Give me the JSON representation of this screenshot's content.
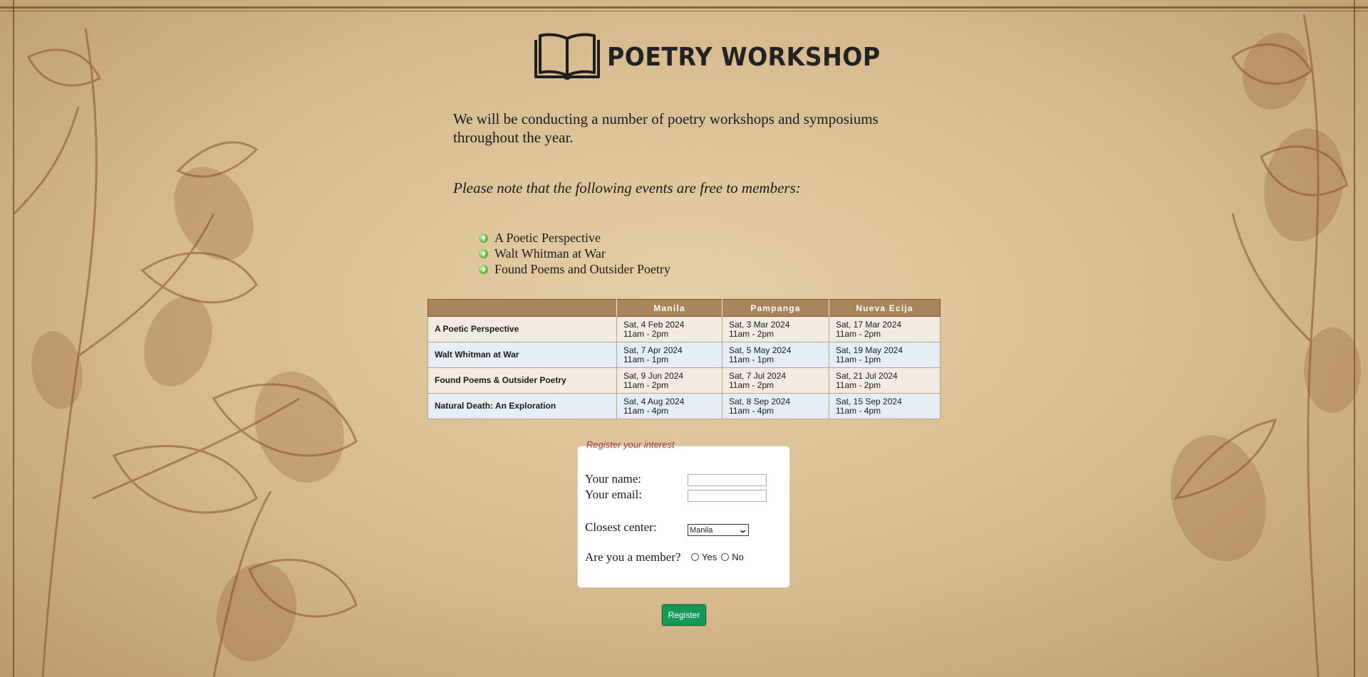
{
  "header": {
    "logo_text": "POETRY WORKSHOP",
    "logo_icon": "open-book-icon"
  },
  "intro": {
    "text": "We will be conducting a number of poetry workshops and symposiums throughout the year.",
    "note": "Please note that the following events are free to members:"
  },
  "free_events": [
    "A Poetic Perspective",
    "Walt Whitman at War",
    "Found Poems and Outsider Poetry"
  ],
  "schedule": {
    "headers": [
      "",
      "Manila",
      "Pampanga",
      "Nueva Ecija"
    ],
    "rows": [
      {
        "event": "A Poetic Perspective",
        "cells": [
          {
            "date": "Sat, 4 Feb 2024",
            "time": "11am - 2pm"
          },
          {
            "date": "Sat, 3 Mar 2024",
            "time": "11am - 2pm"
          },
          {
            "date": "Sat, 17 Mar 2024",
            "time": "11am - 2pm"
          }
        ]
      },
      {
        "event": "Walt Whitman at War",
        "cells": [
          {
            "date": "Sat, 7 Apr 2024",
            "time": "11am - 1pm"
          },
          {
            "date": "Sat, 5 May 2024",
            "time": "11am - 1pm"
          },
          {
            "date": "Sat, 19 May 2024",
            "time": "11am - 1pm"
          }
        ]
      },
      {
        "event": "Found Poems & Outsider Poetry",
        "cells": [
          {
            "date": "Sat, 9 Jun 2024",
            "time": "11am - 2pm"
          },
          {
            "date": "Sat, 7 Jul 2024",
            "time": "11am - 2pm"
          },
          {
            "date": "Sat, 21 Jul 2024",
            "time": "11am - 2pm"
          }
        ]
      },
      {
        "event": "Natural Death: An Exploration",
        "cells": [
          {
            "date": "Sat, 4 Aug 2024",
            "time": "11am - 4pm"
          },
          {
            "date": "Sat, 8 Sep 2024",
            "time": "11am - 4pm"
          },
          {
            "date": "Sat, 15 Sep 2024",
            "time": "11am - 4pm"
          }
        ]
      }
    ]
  },
  "form": {
    "legend": "Register your interest",
    "name_label": "Your name:",
    "name_value": "",
    "email_label": "Your email:",
    "email_value": "",
    "center_label": "Closest center:",
    "center_selected": "Manila",
    "member_label": "Are you a member?",
    "member_options": [
      "Yes",
      "No"
    ],
    "submit_label": "Register"
  },
  "colors": {
    "table_header": "#a8855a",
    "row_odd": "#f1ebe2",
    "row_even": "#e6eef5",
    "legend_text": "#a0403c",
    "register_button": "#149a56"
  }
}
